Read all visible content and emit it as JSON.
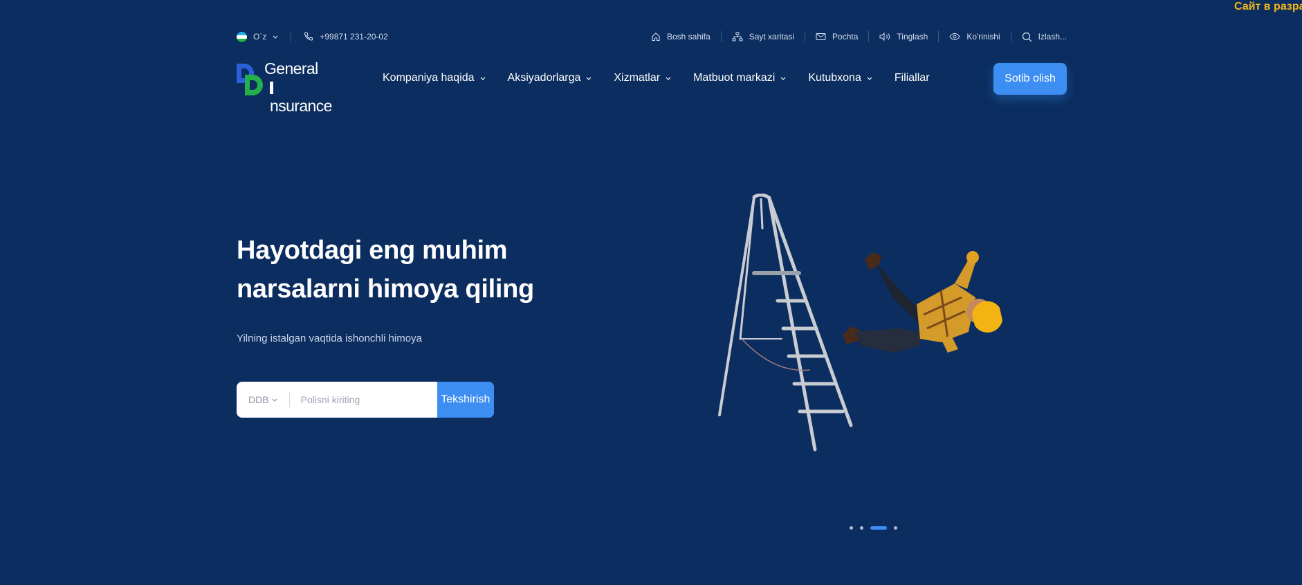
{
  "dev_banner": "Сайт в разра",
  "topbar": {
    "language": "O`z",
    "phone": "+99871 231-20-02",
    "links": [
      {
        "label": "Bosh sahifa",
        "icon": "home-icon"
      },
      {
        "label": "Sayt xaritasi",
        "icon": "sitemap-icon"
      },
      {
        "label": "Pochta",
        "icon": "mail-icon"
      },
      {
        "label": "Tinglash",
        "icon": "speaker-icon"
      },
      {
        "label": "Ko'rinishi",
        "icon": "eye-icon"
      },
      {
        "label": "Izlash...",
        "icon": "search-icon"
      }
    ]
  },
  "logo": {
    "line1": "General",
    "line2": "nsurance",
    "mark_colors": {
      "d1": "#2b5fd9",
      "d2": "#22b04b"
    }
  },
  "nav": {
    "items": [
      {
        "label": "Kompaniya haqida",
        "dropdown": true
      },
      {
        "label": "Aksiyadorlarga",
        "dropdown": true
      },
      {
        "label": "Xizmatlar",
        "dropdown": true
      },
      {
        "label": "Matbuot markazi",
        "dropdown": true
      },
      {
        "label": "Kutubxona",
        "dropdown": true
      },
      {
        "label": "Filiallar",
        "dropdown": false
      }
    ],
    "buy_label": "Sotib olish"
  },
  "hero": {
    "title_line1": "Hayotdagi eng muhim",
    "title_line2": "narsalarni himoya qiling",
    "subtitle": "Yilning istalgan vaqtida ishonchli himoya",
    "search": {
      "select_value": "DDB",
      "placeholder": "Polisni kiriting",
      "button_label": "Tekshirish"
    }
  },
  "slider": {
    "count": 4,
    "active_index": 2
  },
  "colors": {
    "background": "#0b2d5f",
    "accent": "#3d8ef2",
    "banner": "#f5b81a"
  }
}
